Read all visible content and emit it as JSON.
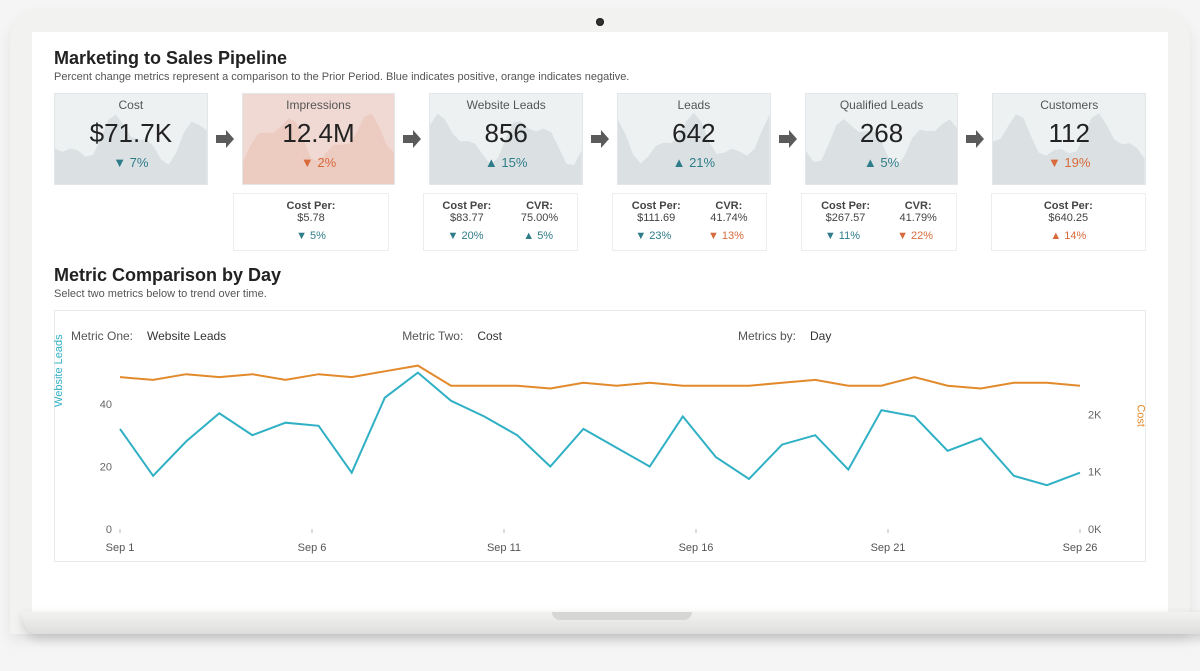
{
  "header": {
    "title": "Marketing to Sales Pipeline",
    "subtitle": "Percent change metrics represent a comparison to the Prior Period. Blue indicates positive, orange indicates negative."
  },
  "funnel": [
    {
      "label": "Cost",
      "value": "$71.7K",
      "delta": "7%",
      "dir": "down",
      "tone": "pos",
      "highlight": false
    },
    {
      "label": "Impressions",
      "value": "12.4M",
      "delta": "2%",
      "dir": "down",
      "tone": "neg",
      "highlight": true
    },
    {
      "label": "Website Leads",
      "value": "856",
      "delta": "15%",
      "dir": "up",
      "tone": "pos",
      "highlight": false
    },
    {
      "label": "Leads",
      "value": "642",
      "delta": "21%",
      "dir": "up",
      "tone": "pos",
      "highlight": false
    },
    {
      "label": "Qualified Leads",
      "value": "268",
      "delta": "5%",
      "dir": "up",
      "tone": "pos",
      "highlight": false
    },
    {
      "label": "Customers",
      "value": "112",
      "delta": "19%",
      "dir": "down",
      "tone": "neg",
      "highlight": false
    }
  ],
  "details": [
    null,
    {
      "cost_per_label": "Cost Per:",
      "cost_per": "$5.78",
      "cvr_label": "",
      "cvr": "",
      "d1": "5%",
      "d1dir": "down",
      "d1tone": "pos",
      "d2": "",
      "d2dir": "",
      "d2tone": ""
    },
    {
      "cost_per_label": "Cost Per:",
      "cost_per": "$83.77",
      "cvr_label": "CVR:",
      "cvr": "75.00%",
      "d1": "20%",
      "d1dir": "down",
      "d1tone": "pos",
      "d2": "5%",
      "d2dir": "up",
      "d2tone": "pos"
    },
    {
      "cost_per_label": "Cost Per:",
      "cost_per": "$111.69",
      "cvr_label": "CVR:",
      "cvr": "41.74%",
      "d1": "23%",
      "d1dir": "down",
      "d1tone": "pos",
      "d2": "13%",
      "d2dir": "down",
      "d2tone": "neg"
    },
    {
      "cost_per_label": "Cost Per:",
      "cost_per": "$267.57",
      "cvr_label": "CVR:",
      "cvr": "41.79%",
      "d1": "11%",
      "d1dir": "down",
      "d1tone": "pos",
      "d2": "22%",
      "d2dir": "down",
      "d2tone": "neg"
    },
    {
      "cost_per_label": "Cost Per:",
      "cost_per": "$640.25",
      "cvr_label": "",
      "cvr": "",
      "d1": "14%",
      "d1dir": "up",
      "d1tone": "neg",
      "d2": "",
      "d2dir": "",
      "d2tone": ""
    }
  ],
  "comparison": {
    "title": "Metric Comparison by Day",
    "subtitle": "Select two metrics below to trend over time.",
    "metric_one_label": "Metric One:",
    "metric_one_value": "Website Leads",
    "metric_two_label": "Metric Two:",
    "metric_two_value": "Cost",
    "metrics_by_label": "Metrics by:",
    "metrics_by_value": "Day",
    "left_axis_title": "Website Leads",
    "right_axis_title": "Cost"
  },
  "chart_data": {
    "type": "line",
    "x_ticks": [
      "Sep 1",
      "Sep 6",
      "Sep 11",
      "Sep 16",
      "Sep 21",
      "Sep 26"
    ],
    "left_axis": {
      "label": "Website Leads",
      "ticks": [
        0,
        20,
        40
      ],
      "range": [
        0,
        55
      ]
    },
    "right_axis": {
      "label": "Cost",
      "ticks": [
        "0K",
        "1K",
        "2K"
      ],
      "range": [
        0,
        3000
      ]
    },
    "series": [
      {
        "name": "Website Leads",
        "axis": "left",
        "color": "#2fb0c4",
        "values": [
          32,
          17,
          28,
          37,
          30,
          34,
          33,
          18,
          42,
          50,
          41,
          36,
          30,
          20,
          32,
          26,
          20,
          36,
          23,
          16,
          27,
          30,
          19,
          38,
          36,
          25,
          29,
          17,
          14,
          18
        ]
      },
      {
        "name": "Cost",
        "axis": "right",
        "color": "#e28a2b",
        "values": [
          2650,
          2600,
          2700,
          2650,
          2700,
          2600,
          2700,
          2650,
          2750,
          2850,
          2500,
          2500,
          2500,
          2450,
          2550,
          2500,
          2550,
          2500,
          2500,
          2500,
          2550,
          2600,
          2500,
          2500,
          2650,
          2500,
          2450,
          2550,
          2550,
          2500
        ]
      }
    ]
  }
}
